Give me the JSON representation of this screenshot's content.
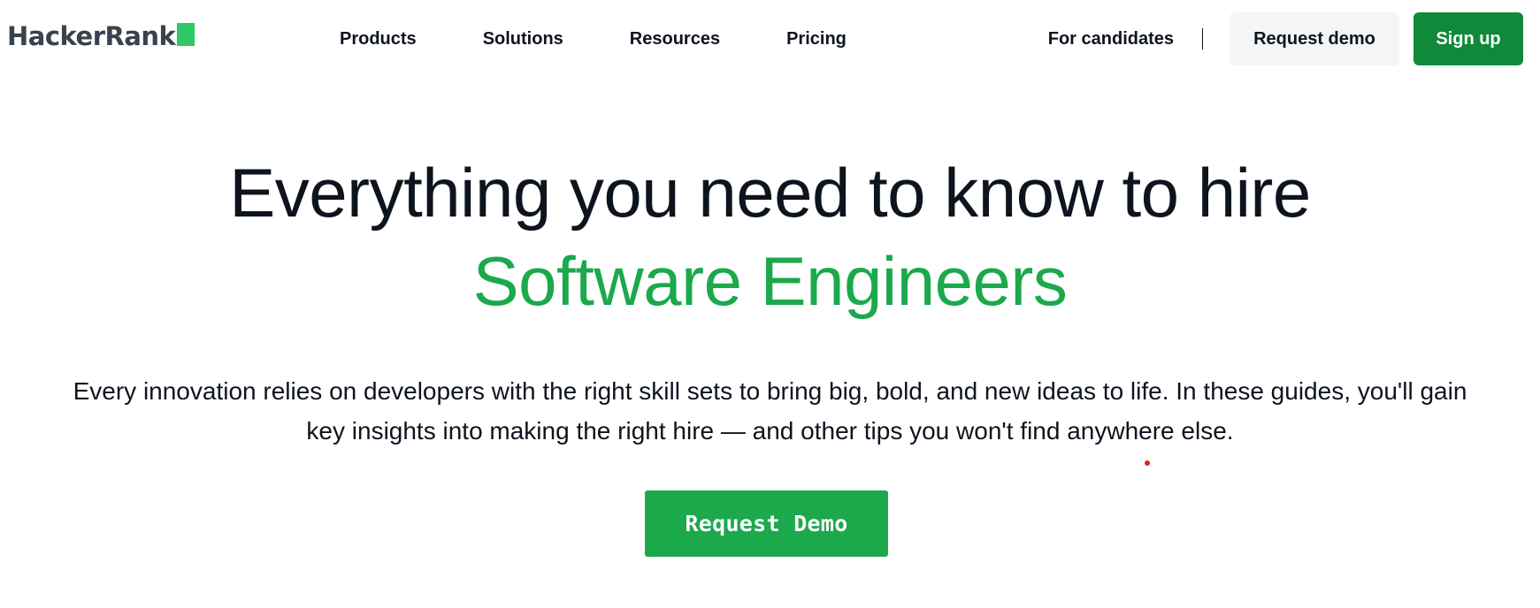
{
  "header": {
    "logo_text": "HackerRank",
    "nav": [
      {
        "label": "Products"
      },
      {
        "label": "Solutions"
      },
      {
        "label": "Resources"
      },
      {
        "label": "Pricing"
      }
    ],
    "candidates_label": "For candidates",
    "request_demo_label": "Request demo",
    "signup_label": "Sign up"
  },
  "hero": {
    "title_line1": "Everything you need to know to hire",
    "title_line2": "Software Engineers",
    "description_line1": "Every innovation relies on developers with the right skill sets to bring big, bold, and new ideas to life. In these guides, you'll gain",
    "description_line2": "key insights into making the right hire — and other tips you won't find anywhere else.",
    "cta_label": "Request Demo"
  },
  "colors": {
    "brand_green": "#2ec866",
    "accent_green": "#1ba94c",
    "signup_green": "#108a3a",
    "text_dark": "#0e141e",
    "logo_text": "#39424e",
    "cursor_dot": "#e0201c"
  }
}
